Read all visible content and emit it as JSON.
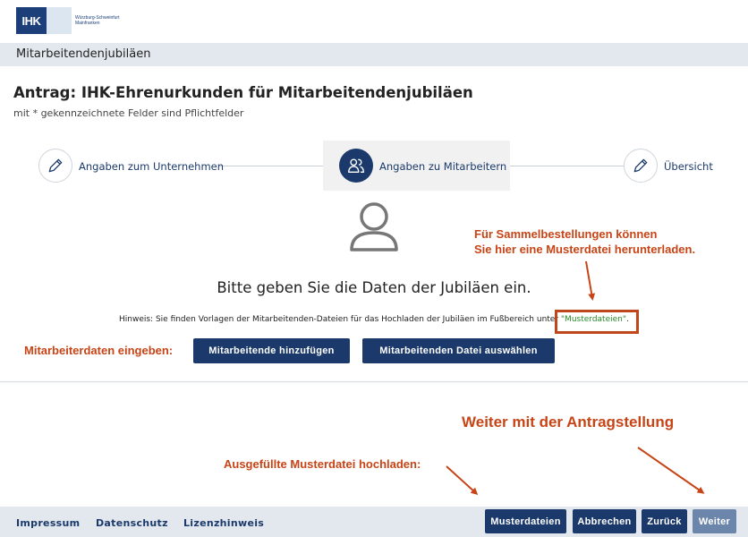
{
  "logo": {
    "mark": "IHK",
    "line1": "Würzburg-Schweinfurt",
    "line2": "Mainfranken"
  },
  "page_header": {
    "title": "Mitarbeitendenjubiläen"
  },
  "form": {
    "title": "Antrag: IHK-Ehrenurkunden für Mitarbeitendenjubiläen",
    "subtitle": "mit * gekennzeichnete Felder sind Pflichtfelder"
  },
  "stepper": {
    "steps": [
      {
        "label": "Angaben zum Unternehmen",
        "icon": "pencil-icon",
        "active": false
      },
      {
        "label": "Angaben zu Mitarbeitern",
        "icon": "users-icon",
        "active": true
      },
      {
        "label": "Übersicht",
        "icon": "pencil-icon",
        "active": false
      }
    ]
  },
  "content": {
    "instruction": "Bitte geben Sie die Daten der Jubiläen ein.",
    "hint_text": "Hinweis: Sie finden Vorlagen der Mitarbeitenden-Dateien für das Hochladen der Jubiläen im Fußbereich unter",
    "hint_link": "\"Musterdateien\"",
    "hint_end": ".",
    "add_employee_button": "Mitarbeitende hinzufügen",
    "select_file_button": "Mitarbeitenden Datei auswählen"
  },
  "annotations": {
    "sammel_line1": "Für Sammelbestellungen können",
    "sammel_line2": "Sie hier eine Musterdatei herunterladen.",
    "enter_data": "Mitarbeiterdaten eingeben:",
    "continue": "Weiter mit der Antragstellung",
    "upload": "Ausgefüllte Musterdatei hochladen:",
    "color": "#c74416"
  },
  "footer": {
    "links": [
      "Impressum",
      "Datenschutz",
      "Lizenzhinweis"
    ],
    "buttons": {
      "templates": "Musterdateien",
      "cancel": "Abbrechen",
      "back": "Zurück",
      "next": "Weiter"
    }
  },
  "colors": {
    "primary": "#1b3a6b",
    "header_bar": "#e3e8ee",
    "link_green": "#2a8a2a",
    "disabled_button": "#6b86aa"
  }
}
